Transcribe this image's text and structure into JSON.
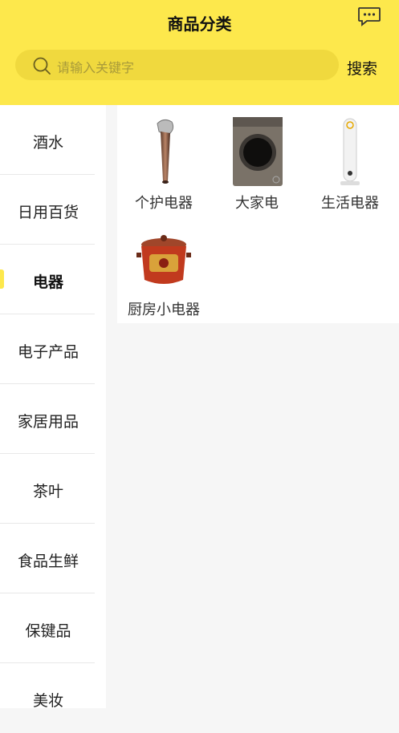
{
  "header": {
    "title": "商品分类",
    "message_icon": "chat-bubble-icon",
    "search_placeholder": "请输入关键字",
    "search_icon": "search-icon",
    "search_button": "搜索",
    "accent_color": "#fde84c"
  },
  "sidebar": {
    "items": [
      {
        "label": "酒水"
      },
      {
        "label": "日用百货"
      },
      {
        "label": "电器"
      },
      {
        "label": "电子产品"
      },
      {
        "label": "家居用品"
      },
      {
        "label": "茶叶"
      },
      {
        "label": "食品生鲜"
      },
      {
        "label": "保键品"
      },
      {
        "label": "美妆"
      }
    ],
    "active_label": "电器"
  },
  "products": [
    {
      "name": "个护电器",
      "icon": "hair-dryer-icon"
    },
    {
      "name": "大家电",
      "icon": "washing-machine-icon"
    },
    {
      "name": "生活电器",
      "icon": "air-purifier-icon"
    },
    {
      "name": "厨房小电器",
      "icon": "slow-cooker-icon"
    }
  ]
}
